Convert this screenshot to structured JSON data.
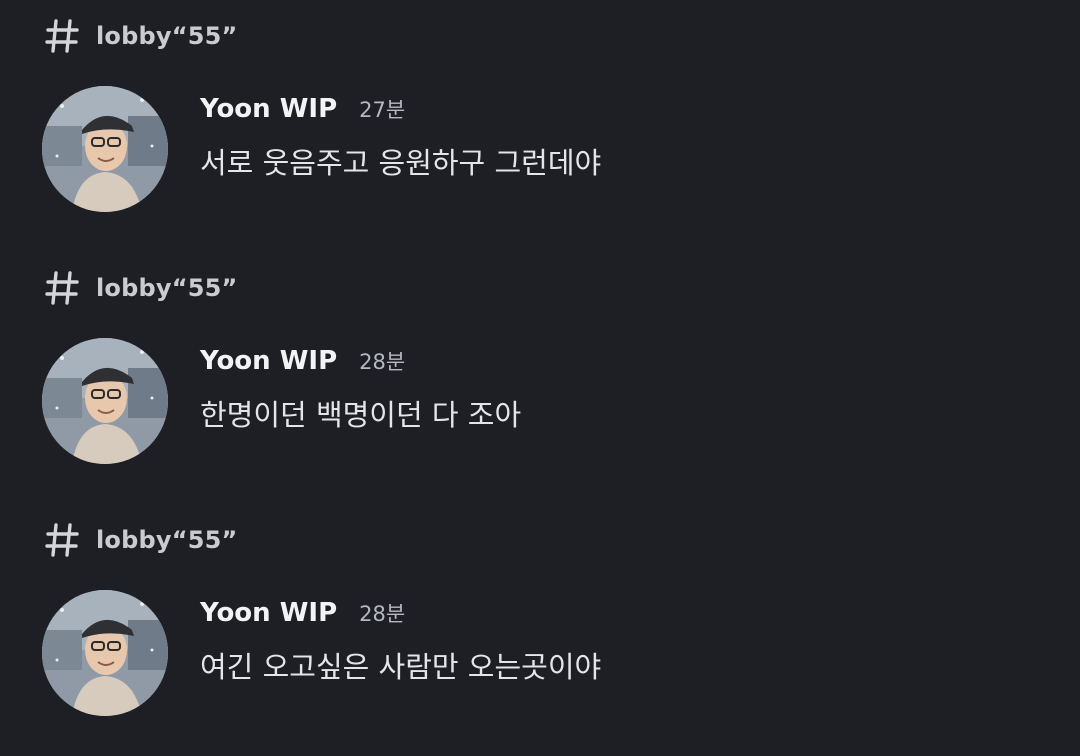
{
  "messages": [
    {
      "channel": "lobby“55”",
      "username": "Yoon WIP",
      "timestamp": "27분",
      "text": "서로 웃음주고 응원하구 그런데야"
    },
    {
      "channel": "lobby“55”",
      "username": "Yoon WIP",
      "timestamp": "28분",
      "text": "한명이던 백명이던 다 조아"
    },
    {
      "channel": "lobby“55”",
      "username": "Yoon WIP",
      "timestamp": "28분",
      "text": "여긴 오고싶은 사람만 오는곳이야"
    }
  ],
  "icons": {
    "channel": "hash-icon",
    "avatar": "user-avatar"
  },
  "colors": {
    "background": "#1e1f24",
    "username": "#f2f3f5",
    "text": "#e3e5e8",
    "muted": "#b5b8bf"
  }
}
